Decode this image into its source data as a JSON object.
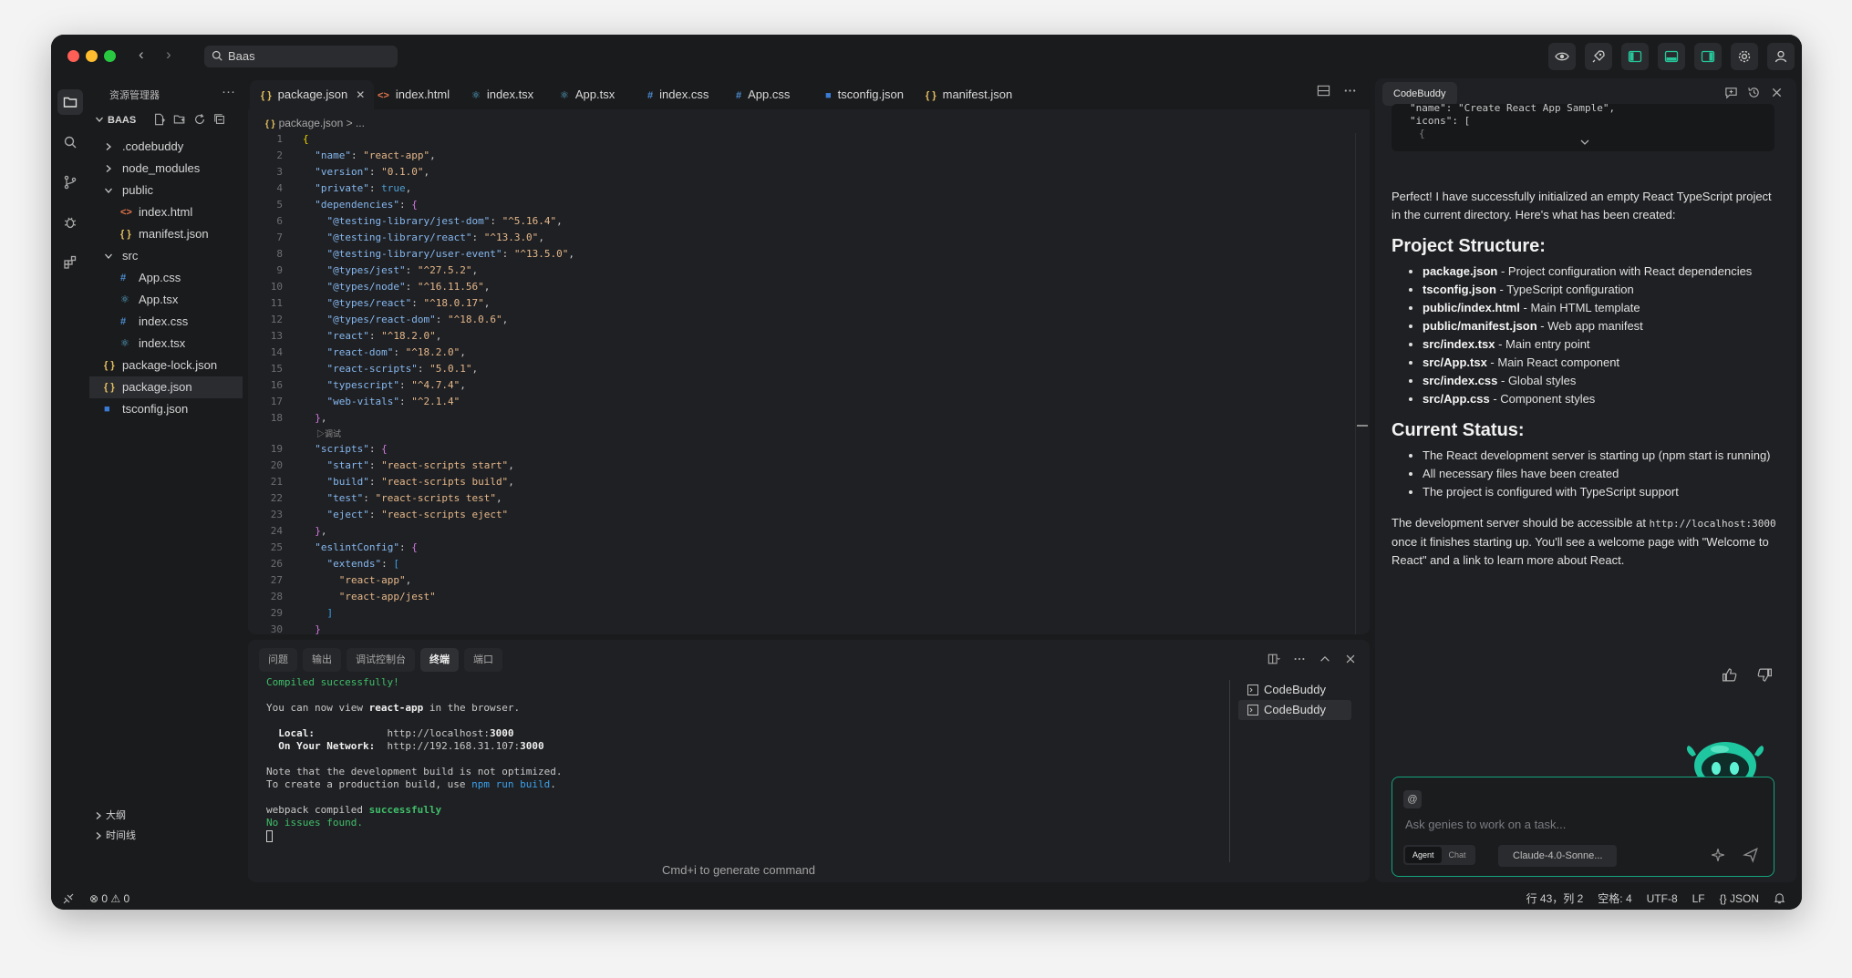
{
  "titlebar": {
    "search_text": "Baas"
  },
  "explorer": {
    "header": "资源管理器",
    "more": "···",
    "root": "BAAS",
    "items": [
      {
        "label": ".codebuddy",
        "type": "folder",
        "expanded": false,
        "depth": 0
      },
      {
        "label": "node_modules",
        "type": "folder",
        "expanded": false,
        "depth": 0
      },
      {
        "label": "public",
        "type": "folder",
        "expanded": true,
        "depth": 0
      },
      {
        "label": "index.html",
        "type": "html",
        "depth": 1
      },
      {
        "label": "manifest.json",
        "type": "json",
        "depth": 1
      },
      {
        "label": "src",
        "type": "folder",
        "expanded": true,
        "depth": 0
      },
      {
        "label": "App.css",
        "type": "css",
        "depth": 1
      },
      {
        "label": "App.tsx",
        "type": "react",
        "depth": 1
      },
      {
        "label": "index.css",
        "type": "css",
        "depth": 1
      },
      {
        "label": "index.tsx",
        "type": "react",
        "depth": 1
      },
      {
        "label": "package-lock.json",
        "type": "json",
        "depth": 0
      },
      {
        "label": "package.json",
        "type": "json",
        "depth": 0,
        "selected": true
      },
      {
        "label": "tsconfig.json",
        "type": "ts",
        "depth": 0
      }
    ],
    "outline": "大纲",
    "timeline": "时间线"
  },
  "editor": {
    "tabs": [
      {
        "label": "package.json",
        "icon": "{}",
        "type": "json",
        "active": true
      },
      {
        "label": "index.html",
        "icon": "<>",
        "type": "html"
      },
      {
        "label": "index.tsx",
        "icon": "⚛",
        "type": "react"
      },
      {
        "label": "App.tsx",
        "icon": "⚛",
        "type": "react"
      },
      {
        "label": "index.css",
        "icon": "#",
        "type": "css"
      },
      {
        "label": "App.css",
        "icon": "#",
        "type": "css"
      },
      {
        "label": "tsconfig.json",
        "icon": "TS",
        "type": "ts"
      },
      {
        "label": "manifest.json",
        "icon": "{}",
        "type": "json"
      }
    ],
    "breadcrumb": {
      "file": "package.json",
      "rest": "> ..."
    },
    "codelens": "▷调试",
    "lines": [
      {
        "n": "1",
        "t": [
          [
            "br1",
            "{"
          ]
        ]
      },
      {
        "n": "2",
        "t": [
          [
            "p",
            "  "
          ],
          [
            "k",
            "\"name\""
          ],
          [
            "p",
            ": "
          ],
          [
            "s",
            "\"react-app\""
          ],
          [
            "p",
            ","
          ]
        ]
      },
      {
        "n": "3",
        "t": [
          [
            "p",
            "  "
          ],
          [
            "k",
            "\"version\""
          ],
          [
            "p",
            ": "
          ],
          [
            "s",
            "\"0.1.0\""
          ],
          [
            "p",
            ","
          ]
        ]
      },
      {
        "n": "4",
        "t": [
          [
            "p",
            "  "
          ],
          [
            "k",
            "\"private\""
          ],
          [
            "p",
            ": "
          ],
          [
            "n",
            "true"
          ],
          [
            "p",
            ","
          ]
        ]
      },
      {
        "n": "5",
        "t": [
          [
            "p",
            "  "
          ],
          [
            "k",
            "\"dependencies\""
          ],
          [
            "p",
            ": "
          ],
          [
            "br2",
            "{"
          ]
        ]
      },
      {
        "n": "6",
        "t": [
          [
            "p",
            "    "
          ],
          [
            "k",
            "\"@testing-library/jest-dom\""
          ],
          [
            "p",
            ": "
          ],
          [
            "s",
            "\"^5.16.4\""
          ],
          [
            "p",
            ","
          ]
        ]
      },
      {
        "n": "7",
        "t": [
          [
            "p",
            "    "
          ],
          [
            "k",
            "\"@testing-library/react\""
          ],
          [
            "p",
            ": "
          ],
          [
            "s",
            "\"^13.3.0\""
          ],
          [
            "p",
            ","
          ]
        ]
      },
      {
        "n": "8",
        "t": [
          [
            "p",
            "    "
          ],
          [
            "k",
            "\"@testing-library/user-event\""
          ],
          [
            "p",
            ": "
          ],
          [
            "s",
            "\"^13.5.0\""
          ],
          [
            "p",
            ","
          ]
        ]
      },
      {
        "n": "9",
        "t": [
          [
            "p",
            "    "
          ],
          [
            "k",
            "\"@types/jest\""
          ],
          [
            "p",
            ": "
          ],
          [
            "s",
            "\"^27.5.2\""
          ],
          [
            "p",
            ","
          ]
        ]
      },
      {
        "n": "10",
        "t": [
          [
            "p",
            "    "
          ],
          [
            "k",
            "\"@types/node\""
          ],
          [
            "p",
            ": "
          ],
          [
            "s",
            "\"^16.11.56\""
          ],
          [
            "p",
            ","
          ]
        ]
      },
      {
        "n": "11",
        "t": [
          [
            "p",
            "    "
          ],
          [
            "k",
            "\"@types/react\""
          ],
          [
            "p",
            ": "
          ],
          [
            "s",
            "\"^18.0.17\""
          ],
          [
            "p",
            ","
          ]
        ]
      },
      {
        "n": "12",
        "t": [
          [
            "p",
            "    "
          ],
          [
            "k",
            "\"@types/react-dom\""
          ],
          [
            "p",
            ": "
          ],
          [
            "s",
            "\"^18.0.6\""
          ],
          [
            "p",
            ","
          ]
        ]
      },
      {
        "n": "13",
        "t": [
          [
            "p",
            "    "
          ],
          [
            "k",
            "\"react\""
          ],
          [
            "p",
            ": "
          ],
          [
            "s",
            "\"^18.2.0\""
          ],
          [
            "p",
            ","
          ]
        ]
      },
      {
        "n": "14",
        "t": [
          [
            "p",
            "    "
          ],
          [
            "k",
            "\"react-dom\""
          ],
          [
            "p",
            ": "
          ],
          [
            "s",
            "\"^18.2.0\""
          ],
          [
            "p",
            ","
          ]
        ]
      },
      {
        "n": "15",
        "t": [
          [
            "p",
            "    "
          ],
          [
            "k",
            "\"react-scripts\""
          ],
          [
            "p",
            ": "
          ],
          [
            "s",
            "\"5.0.1\""
          ],
          [
            "p",
            ","
          ]
        ]
      },
      {
        "n": "16",
        "t": [
          [
            "p",
            "    "
          ],
          [
            "k",
            "\"typescript\""
          ],
          [
            "p",
            ": "
          ],
          [
            "s",
            "\"^4.7.4\""
          ],
          [
            "p",
            ","
          ]
        ]
      },
      {
        "n": "17",
        "t": [
          [
            "p",
            "    "
          ],
          [
            "k",
            "\"web-vitals\""
          ],
          [
            "p",
            ": "
          ],
          [
            "s",
            "\"^2.1.4\""
          ]
        ]
      },
      {
        "n": "18",
        "t": [
          [
            "p",
            "  "
          ],
          [
            "br2",
            "}"
          ],
          [
            "p",
            ","
          ]
        ]
      },
      {
        "codelens": true
      },
      {
        "n": "19",
        "t": [
          [
            "p",
            "  "
          ],
          [
            "k",
            "\"scripts\""
          ],
          [
            "p",
            ": "
          ],
          [
            "br2",
            "{"
          ]
        ]
      },
      {
        "n": "20",
        "t": [
          [
            "p",
            "    "
          ],
          [
            "k",
            "\"start\""
          ],
          [
            "p",
            ": "
          ],
          [
            "s",
            "\"react-scripts start\""
          ],
          [
            "p",
            ","
          ]
        ]
      },
      {
        "n": "21",
        "t": [
          [
            "p",
            "    "
          ],
          [
            "k",
            "\"build\""
          ],
          [
            "p",
            ": "
          ],
          [
            "s",
            "\"react-scripts build\""
          ],
          [
            "p",
            ","
          ]
        ]
      },
      {
        "n": "22",
        "t": [
          [
            "p",
            "    "
          ],
          [
            "k",
            "\"test\""
          ],
          [
            "p",
            ": "
          ],
          [
            "s",
            "\"react-scripts test\""
          ],
          [
            "p",
            ","
          ]
        ]
      },
      {
        "n": "23",
        "t": [
          [
            "p",
            "    "
          ],
          [
            "k",
            "\"eject\""
          ],
          [
            "p",
            ": "
          ],
          [
            "s",
            "\"react-scripts eject\""
          ]
        ]
      },
      {
        "n": "24",
        "t": [
          [
            "p",
            "  "
          ],
          [
            "br2",
            "}"
          ],
          [
            "p",
            ","
          ]
        ]
      },
      {
        "n": "25",
        "t": [
          [
            "p",
            "  "
          ],
          [
            "k",
            "\"eslintConfig\""
          ],
          [
            "p",
            ": "
          ],
          [
            "br2",
            "{"
          ]
        ]
      },
      {
        "n": "26",
        "t": [
          [
            "p",
            "    "
          ],
          [
            "k",
            "\"extends\""
          ],
          [
            "p",
            ": "
          ],
          [
            "br3",
            "["
          ]
        ]
      },
      {
        "n": "27",
        "t": [
          [
            "p",
            "      "
          ],
          [
            "s",
            "\"react-app\""
          ],
          [
            "p",
            ","
          ]
        ]
      },
      {
        "n": "28",
        "t": [
          [
            "p",
            "      "
          ],
          [
            "s",
            "\"react-app/jest\""
          ]
        ]
      },
      {
        "n": "29",
        "t": [
          [
            "p",
            "    "
          ],
          [
            "br3",
            "]"
          ]
        ]
      },
      {
        "n": "30",
        "t": [
          [
            "p",
            "  "
          ],
          [
            "br2",
            "}"
          ]
        ]
      }
    ]
  },
  "panel": {
    "tabs": [
      {
        "label": "问题"
      },
      {
        "label": "输出"
      },
      {
        "label": "调试控制台"
      },
      {
        "label": "终端",
        "active": true
      },
      {
        "label": "端口"
      }
    ],
    "output": [
      [
        [
          "tgreen",
          "Compiled successfully!"
        ]
      ],
      [],
      [
        [
          "p",
          "You can now view "
        ],
        [
          "tbold",
          "react-app"
        ],
        [
          "p",
          " in the browser."
        ]
      ],
      [],
      [
        [
          "tbold",
          "  Local:"
        ],
        [
          "p",
          "            http://localhost:"
        ],
        [
          "tbold",
          "3000"
        ]
      ],
      [
        [
          "tbold",
          "  On Your Network:"
        ],
        [
          "p",
          "  http://192.168.31.107:"
        ],
        [
          "tbold",
          "3000"
        ]
      ],
      [],
      [
        [
          "p",
          "Note that the development build is not optimized."
        ]
      ],
      [
        [
          "p",
          "To create a production build, use "
        ],
        [
          "tcyan",
          "npm run build"
        ],
        [
          "p",
          "."
        ]
      ],
      [],
      [
        [
          "p",
          "webpack compiled "
        ],
        [
          "tgreen-b",
          "successfully"
        ]
      ],
      [
        [
          "tgreen",
          "No issues found."
        ]
      ]
    ],
    "terminals": [
      {
        "label": "CodeBuddy"
      },
      {
        "label": "CodeBuddy",
        "active": true
      }
    ],
    "hint": "Cmd+i to generate command"
  },
  "chat": {
    "tab": "CodeBuddy",
    "code_line1": "\"name\": \"Create React App Sample\",",
    "code_line2": "\"icons\": [",
    "code_line3": "{",
    "intro": "Perfect! I have successfully initialized an empty React TypeScript project in the current directory. Here's what has been created:",
    "structure_heading": "Project Structure:",
    "structure": [
      {
        "b": "package.json",
        "t": " - Project configuration with React dependencies"
      },
      {
        "b": "tsconfig.json",
        "t": " - TypeScript configuration"
      },
      {
        "b": "public/index.html",
        "t": " - Main HTML template"
      },
      {
        "b": "public/manifest.json",
        "t": " - Web app manifest"
      },
      {
        "b": "src/index.tsx",
        "t": " - Main entry point"
      },
      {
        "b": "src/App.tsx",
        "t": " - Main React component"
      },
      {
        "b": "src/index.css",
        "t": " - Global styles"
      },
      {
        "b": "src/App.css",
        "t": " - Component styles"
      }
    ],
    "status_heading": "Current Status:",
    "status": [
      "The React development server is starting up (npm start is running)",
      "All necessary files have been created",
      "The project is configured with TypeScript support"
    ],
    "outro_1": "The development server should be accessible at ",
    "outro_url": "http://localhost:3000",
    "outro_2": " once it finishes starting up. You'll see a welcome page with \"Welcome to React\" and a link to learn more about React.",
    "input": {
      "at": "@",
      "placeholder": "Ask genies to work on a task...",
      "mode_agent": "Agent",
      "mode_chat": "Chat",
      "model": "Claude-4.0-Sonne..."
    }
  },
  "statusbar": {
    "problems": "⊗ 0 ⚠ 0",
    "position": "行 43，列 2",
    "spaces": "空格: 4",
    "encoding": "UTF-8",
    "eol": "LF",
    "language": "{} JSON"
  },
  "colors": {
    "accent": "#14a37f",
    "json_icon": "#e4c060",
    "html_icon": "#e3764c",
    "css_icon": "#4d8fd6",
    "react_icon": "#5bb7de",
    "ts_icon": "#3a7bd5"
  }
}
